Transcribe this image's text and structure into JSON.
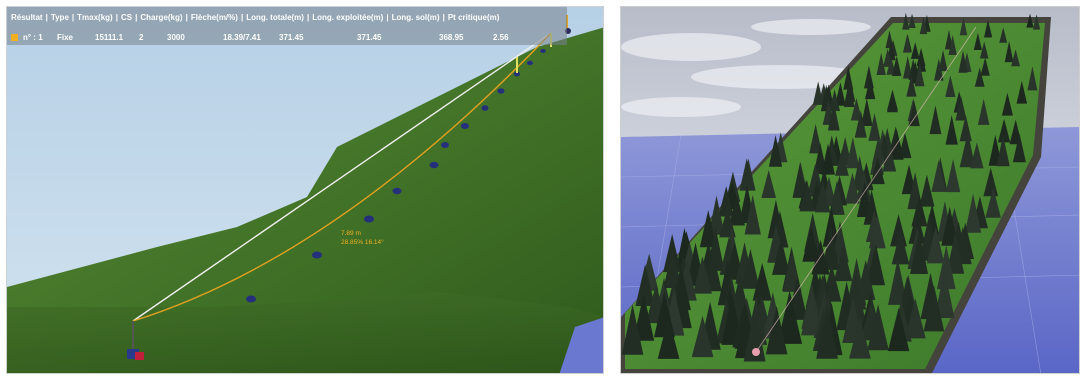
{
  "result_table": {
    "headers": [
      "Résultat",
      "Type",
      "Tmax(kg)",
      "CS",
      "Charge(kg)",
      "Flèche(m/%)",
      "Long. totale(m)",
      "Long. exploitée(m)",
      "Long. sol(m)",
      "Pt critique(m)"
    ],
    "row": {
      "label": "n° : 1",
      "values": [
        "Fixe",
        "15111.1",
        "2",
        "3000",
        "18.39/7.41",
        "371.45",
        "371.45",
        "368.95",
        "2.56"
      ]
    },
    "marker_color": "#f0b020"
  },
  "cable_annotation": {
    "line1": "7.89 m",
    "line2": "28.85%  16.14°"
  },
  "colors": {
    "sky_left": "#c3d9ea",
    "hillside": "#4a7a2c",
    "cable_fixed": "#f0f0f0",
    "cable_loaded": "#e0a020",
    "support": "#24307a",
    "water": "#6a78d0"
  }
}
